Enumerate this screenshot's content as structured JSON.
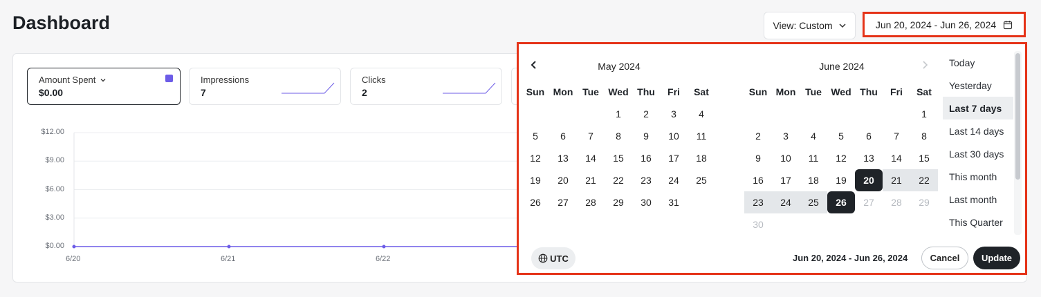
{
  "header": {
    "title": "Dashboard",
    "view_label": "View: Custom",
    "date_range": "Jun 20, 2024 - Jun 26, 2024"
  },
  "metrics": [
    {
      "label": "Amount Spent",
      "value": "$0.00",
      "active": true,
      "color": "#6c5ce7"
    },
    {
      "label": "Impressions",
      "value": "7"
    },
    {
      "label": "Clicks",
      "value": "2"
    }
  ],
  "chart_data": {
    "type": "line",
    "x": [
      "6/20",
      "6/21",
      "6/22"
    ],
    "y_ticks": [
      "$12.00",
      "$9.00",
      "$6.00",
      "$3.00",
      "$0.00"
    ],
    "ylim": [
      0,
      12
    ],
    "series": [
      {
        "values": [
          0,
          0,
          0
        ],
        "color": "#6c5ce7"
      }
    ]
  },
  "calendar": {
    "left_month": "May 2024",
    "right_month": "June 2024",
    "weekdays": [
      "Sun",
      "Mon",
      "Tue",
      "Wed",
      "Thu",
      "Fri",
      "Sat"
    ],
    "may_days": [
      "1",
      "2",
      "3",
      "4",
      "5",
      "6",
      "7",
      "8",
      "9",
      "10",
      "11",
      "12",
      "13",
      "14",
      "15",
      "16",
      "17",
      "18",
      "19",
      "20",
      "21",
      "22",
      "23",
      "24",
      "25",
      "26",
      "27",
      "28",
      "29",
      "30",
      "31"
    ],
    "june_days": [
      "1",
      "2",
      "3",
      "4",
      "5",
      "6",
      "7",
      "8",
      "9",
      "10",
      "11",
      "12",
      "13",
      "14",
      "15",
      "16",
      "17",
      "18",
      "19",
      "20",
      "21",
      "22",
      "23",
      "24",
      "25",
      "26",
      "27",
      "28",
      "29",
      "30"
    ],
    "range_start": "20",
    "range_end": "26",
    "presets": [
      "Today",
      "Yesterday",
      "Last 7 days",
      "Last 14 days",
      "Last 30 days",
      "This month",
      "Last month",
      "This Quarter"
    ],
    "active_preset": "Last 7 days",
    "timezone": "UTC",
    "summary": "Jun 20, 2024 - Jun 26, 2024",
    "cancel_label": "Cancel",
    "update_label": "Update"
  }
}
